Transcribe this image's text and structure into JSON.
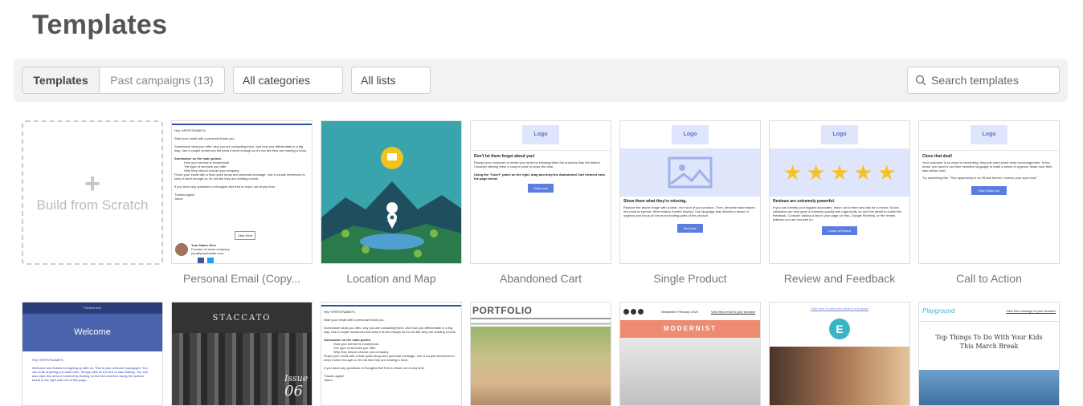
{
  "page": {
    "title": "Templates"
  },
  "toolbar": {
    "tabs": {
      "templates": "Templates",
      "past": "Past campaigns (13)"
    },
    "categories": "All categories",
    "lists": "All lists",
    "search_placeholder": "Search templates"
  },
  "scratch": {
    "label": "Build from Scratch"
  },
  "row1": [
    {
      "caption": "Personal Email (Copy..."
    },
    {
      "caption": "Location and Map"
    },
    {
      "caption": "Abandoned Cart"
    },
    {
      "caption": "Single Product"
    },
    {
      "caption": "Review and Feedback"
    },
    {
      "caption": "Call to Action"
    }
  ],
  "thumbs": {
    "logo": "Logo",
    "personal": {
      "greet": "Hey %FIRSTNAME%,",
      "l1": "Start your email with a personal thank you.",
      "l2": "Summarize what you offer, why you are contacting them, and how you differentiate in a big way. Use a couple sentences but keep it short enough so it's not like they are reading a book.",
      "head": "Summarize so the main points:",
      "b1": "How your service is exceptional",
      "b2": "The type of services you offer",
      "b3": "Why they should choose you company",
      "l3": "Finish your email with a final quick recap and personal message. Use a couple sentences to keep it short enough so it's not like they are reading a book.",
      "l4": "If you have any questions or thoughts feel free to reach out at any time.",
      "sign1": "Thanks again!",
      "sign2": "Jason",
      "btn": "Click Here",
      "name": "Your Name Here",
      "role": "Founder of some company",
      "mail": "you@yourdomain.com"
    },
    "abandoned": {
      "h": "Don't let them forget about you!",
      "p": "Prompt your customer to revisit your store by showing them the products they left behind. Consider offering them a coupon code to close the deal.",
      "h2": "Using the \"Insert\" panel on the right, drag and drop the Abandoned Cart element onto the page below.",
      "btn": "Shop now"
    },
    "single": {
      "h": "Show them what they're missing.",
      "p": "Replace the above image with a clear, nice shot of your product. Then, describe what makes this product special. What makes it worth buying? Use language that delivers a sense of urgency and focus on the most exciting parts of the product.",
      "btn": "Buy Now"
    },
    "review": {
      "h": "Reviews are extremely powerful.",
      "p": "If you can identify your biggest advocates, reach out to them and ask for a review. Social validation can help grow a business quickly and organically, so don't be afraid to solicit this feedback. Consider adding a link to your page on Yelp, Google Reviews, or the review platform you are focused on.",
      "btn": "Leave a Review"
    },
    "cta": {
      "h": "Close that deal!",
      "p": "Your customer is so close to converting, they just need some extra encouragement. In the email, you want to use time sensitive language to instill a sense of urgency. Make sure they take action now!",
      "p2": "Try something like \"This opportunity is so it'll last forever, reserve your spot now!\"",
      "btn": "Don't Miss Out"
    },
    "welcome": {
      "top": "Preview text",
      "title": "Welcome",
      "greet": "Hey %FIRSTNAME%,",
      "p": "Welcome and thanks for signing up with us. This is your welcome paragraph. You can write anything you want here. Simply click on the text to start editing. You can also style this area of content by clicking on the text and then using the options found in the right side bar of this page."
    },
    "staccato": {
      "brand": "STACCATO",
      "issue": "Issue",
      "num": "06"
    },
    "portfolio": {
      "title": "PORTFOLIO"
    },
    "modernist": {
      "date": "Newsletter February 2020",
      "view": "View this email in your browser",
      "brand": "MODERNIST"
    },
    "estore": {
      "link": "Click here to view this email in a browser",
      "letter": "E"
    },
    "playground": {
      "brand": "Playground",
      "view": "View this message in your browser",
      "h": "Top Things To Do With Your Kids This March Break"
    }
  }
}
